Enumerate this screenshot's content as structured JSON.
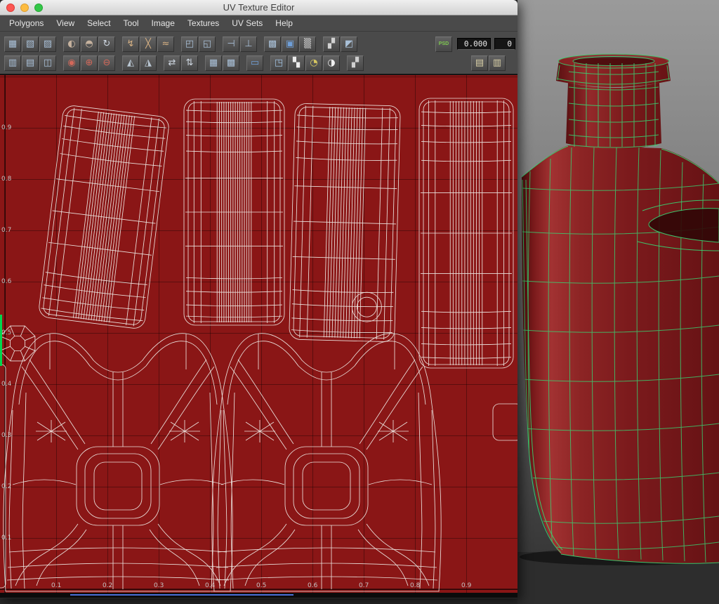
{
  "window": {
    "title": "UV Texture Editor"
  },
  "menu_bar": {
    "items": [
      "Polygons",
      "View",
      "Select",
      "Tool",
      "Image",
      "Textures",
      "UV Sets",
      "Help"
    ]
  },
  "toolbar": {
    "value_field_1": "0.000",
    "value_field_2": "0",
    "row1": [
      {
        "name": "uv-lattice-tool-button",
        "icon": "lattice-grid-icon",
        "glyph": "▦",
        "color": "#a9c0d8"
      },
      {
        "name": "uv-move-tool-button",
        "icon": "move-grid-icon",
        "glyph": "▧",
        "color": "#a9c0d8"
      },
      {
        "name": "uv-smudge-tool-button",
        "icon": "smudge-grid-icon",
        "glyph": "▨",
        "color": "#a9c0d8"
      },
      {
        "name": "flip-u-button",
        "icon": "flip-u-icon",
        "glyph": "◐",
        "color": "#c6b29e",
        "gap": true
      },
      {
        "name": "flip-v-button",
        "icon": "flip-v-icon",
        "glyph": "◓",
        "color": "#c6b29e"
      },
      {
        "name": "rotate-uvs-button",
        "icon": "rotate-ccw-icon",
        "glyph": "↻",
        "color": "#cdd6e0"
      },
      {
        "name": "cut-uvs-button",
        "icon": "cut-edges-icon",
        "glyph": "↯",
        "color": "#d8b284",
        "gap": true
      },
      {
        "name": "split-uvs-button",
        "icon": "split-edges-icon",
        "glyph": "╳",
        "color": "#d8b284"
      },
      {
        "name": "sew-uvs-button",
        "icon": "sew-edges-icon",
        "glyph": "≈",
        "color": "#d8b284"
      },
      {
        "name": "layout-uvs-button",
        "icon": "layout-grid-icon",
        "glyph": "◰",
        "color": "#a9c0d8",
        "gap": true
      },
      {
        "name": "unfold-uvs-button",
        "icon": "unfold-icon",
        "glyph": "◱",
        "color": "#a9c0d8"
      },
      {
        "name": "align-u-button",
        "icon": "align-left-icon",
        "glyph": "⊣",
        "color": "#a9c0d8",
        "gap": true
      },
      {
        "name": "align-v-button",
        "icon": "align-bottom-icon",
        "glyph": "⊥",
        "color": "#a9c0d8"
      },
      {
        "name": "snap-grid-button",
        "icon": "grid-snap-icon",
        "glyph": "▩",
        "color": "#a9c0d8",
        "gap": true
      },
      {
        "name": "display-image-button",
        "icon": "image-display-icon",
        "glyph": "▣",
        "color": "#6f9fd8"
      },
      {
        "name": "dither-image-button",
        "icon": "dither-icon",
        "glyph": "▒",
        "color": "#d2d2d2"
      },
      {
        "name": "shade-uvs-button",
        "icon": "shade-checker-icon",
        "glyph": "▞",
        "color": "#d2d2d2",
        "gap": true
      },
      {
        "name": "texture-borders-button",
        "icon": "border-edges-icon",
        "glyph": "◩",
        "color": "#a9c0d8"
      },
      {
        "name": "create-psd-button",
        "icon": "psd-icon",
        "glyph": "PSD",
        "color": "#7ec850",
        "end": true,
        "text": true
      }
    ],
    "row2": [
      {
        "name": "uv-rotate-tool-button",
        "icon": "rotate-grid-icon",
        "glyph": "▥",
        "color": "#a9c0d8"
      },
      {
        "name": "uv-scale-tool-button",
        "icon": "scale-grid-icon",
        "glyph": "▤",
        "color": "#a9c0d8"
      },
      {
        "name": "uv-select-tool-button",
        "icon": "select-grid-icon",
        "glyph": "◫",
        "color": "#a9c0d8"
      },
      {
        "name": "isolate-select-button",
        "icon": "isolate-view-icon",
        "glyph": "◉",
        "color": "#d2685a",
        "gap": true
      },
      {
        "name": "isolate-add-button",
        "icon": "isolate-add-icon",
        "glyph": "⊕",
        "color": "#d2685a"
      },
      {
        "name": "isolate-remove-button",
        "icon": "isolate-remove-icon",
        "glyph": "⊖",
        "color": "#d2685a"
      },
      {
        "name": "flip-shell-button",
        "icon": "flip-triangle-icon",
        "glyph": "◭",
        "color": "#b9c6d2",
        "gap": true
      },
      {
        "name": "rotate-shell-button",
        "icon": "rotate-triangle-icon",
        "glyph": "◮",
        "color": "#b9c6d2"
      },
      {
        "name": "move-u-button",
        "icon": "arrows-horizontal-icon",
        "glyph": "⇄",
        "color": "#cdd6e0",
        "gap": true
      },
      {
        "name": "move-v-button",
        "icon": "arrows-vertical-icon",
        "glyph": "⇅",
        "color": "#cdd6e0"
      },
      {
        "name": "grid-uvs-button",
        "icon": "grid-all-icon",
        "glyph": "▦",
        "color": "#a9c0d8",
        "gap": true
      },
      {
        "name": "pixel-snap-button",
        "icon": "pixel-grid-icon",
        "glyph": "▩",
        "color": "#a9c0d8"
      },
      {
        "name": "image-range-button",
        "icon": "image-range-icon",
        "glyph": "▭",
        "color": "#6f9fd8",
        "gap": true
      },
      {
        "name": "copy-uvs-button",
        "icon": "copy-stack-icon",
        "glyph": "◳",
        "color": "#9fc0e0",
        "gap": true
      },
      {
        "name": "checker-display-button",
        "icon": "checker-icon",
        "glyph": "▚",
        "color": "#ececec"
      },
      {
        "name": "rgb-channels-button",
        "icon": "rgb-circle-icon",
        "glyph": "◔",
        "color": "#d8c860"
      },
      {
        "name": "alpha-channel-button",
        "icon": "alpha-circle-icon",
        "glyph": "◑",
        "color": "#f0f0f0"
      },
      {
        "name": "tile-checker-button",
        "icon": "tile-checker-icon",
        "glyph": "▞",
        "color": "#cfcfcf",
        "gap": true
      },
      {
        "name": "copy-value-button",
        "icon": "clipboard-copy-icon",
        "glyph": "▤",
        "color": "#d8cfa6",
        "end": true
      },
      {
        "name": "paste-value-button",
        "icon": "clipboard-paste-icon",
        "glyph": "▥",
        "color": "#d8cfa6"
      }
    ]
  },
  "uv_canvas": {
    "v_axis_ticks": [
      "0.9",
      "0.8",
      "0.7",
      "0.6",
      "0.5",
      "0.4",
      "0.3",
      "0.2",
      "0.1"
    ],
    "u_axis_ticks": [
      "0.1",
      "0.2",
      "0.3",
      "0.4",
      "0.5",
      "0.6",
      "0.7",
      "0.8",
      "0.9"
    ]
  },
  "colors": {
    "canvas_bg": "#8a1616",
    "uv_wire": "#f1ede8",
    "grid_line": "rgba(0,0,0,0.34)",
    "viewport_wire": "#38d673",
    "bottle_red": "#7c1b1c",
    "axis_green": "#00d64e",
    "scroll_blue": "#4a6fd8"
  }
}
